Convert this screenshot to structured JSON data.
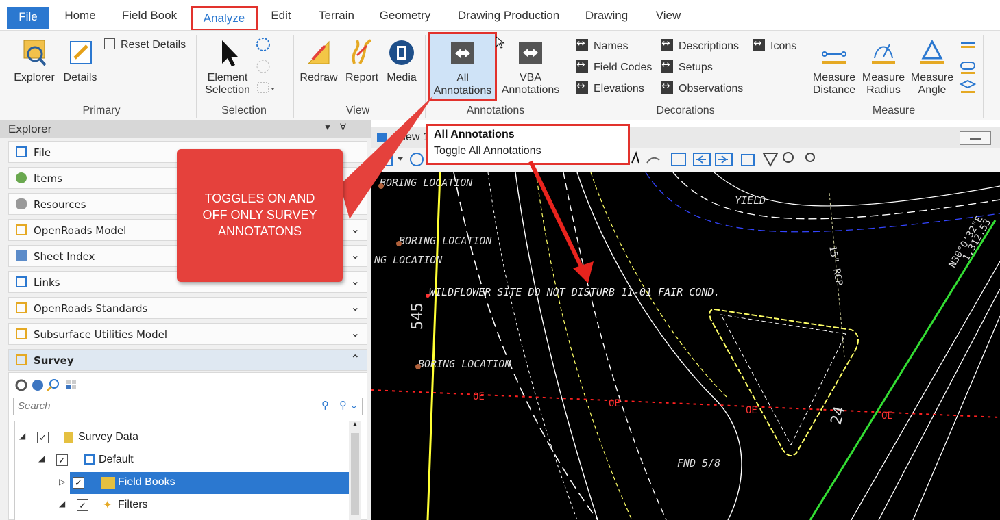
{
  "tabs": [
    "File",
    "Home",
    "Field Book",
    "Analyze",
    "Edit",
    "Terrain",
    "Geometry",
    "Drawing Production",
    "Drawing",
    "View"
  ],
  "ribbon": {
    "primary": {
      "explorer": "Explorer",
      "details": "Details",
      "reset_details": "Reset Details",
      "group": "Primary"
    },
    "selection": {
      "element_line1": "Element",
      "element_line2": "Selection",
      "group": "Selection"
    },
    "view": {
      "redraw": "Redraw",
      "report": "Report",
      "media": "Media",
      "group": "View"
    },
    "annotations": {
      "all_line1": "All",
      "all_line2": "Annotations",
      "vba_line1": "VBA",
      "vba_line2": "Annotations",
      "group": "Annotations"
    },
    "decorations": {
      "names": "Names",
      "field_codes": "Field Codes",
      "elevations": "Elevations",
      "descriptions": "Descriptions",
      "setups": "Setups",
      "observations": "Observations",
      "icons": "Icons",
      "group": "Decorations"
    },
    "measure": {
      "distance_line1": "Measure",
      "distance_line2": "Distance",
      "radius_line1": "Measure",
      "radius_line2": "Radius",
      "angle_line1": "Measure",
      "angle_line2": "Angle",
      "group": "Measure"
    }
  },
  "explorer": {
    "title": "Explorer",
    "rows": [
      "File",
      "Items",
      "Resources",
      "OpenRoads Model",
      "Sheet Index",
      "Links",
      "OpenRoads Standards",
      "Subsurface Utilities Model",
      "Survey"
    ],
    "search_placeholder": "Search",
    "tree": [
      "Survey Data",
      "Default",
      "Field Books",
      "Filters"
    ]
  },
  "view": {
    "title": "View 1"
  },
  "tooltip": {
    "title": "All Annotations",
    "desc": "Toggle All Annotations"
  },
  "callout": {
    "line1": "TOGGLES ON AND",
    "line2": "OFF ONLY SURVEY",
    "line3": "ANNOTATONS"
  },
  "canvas_text": {
    "boring1": "BORING LOCATION",
    "boring2": "BORING LOCATION",
    "boring3": "NG LOCATION",
    "boring4": "BORING LOCATION",
    "yield": "YIELD",
    "wildflower": "WILDFLOWER SITE  DO NOT DISTURB  11-01  FAIR COND.",
    "station": "545",
    "oe": "OE",
    "fnd": "FND 5/8",
    "rcp": "15\" RCP",
    "bearing": "N30°0'32\"E",
    "dist": "1,312.53",
    "twentyfour": "24"
  },
  "colors": {
    "accent": "#2b78d0",
    "callout": "#e5413c",
    "highlight": "#e2322d"
  }
}
